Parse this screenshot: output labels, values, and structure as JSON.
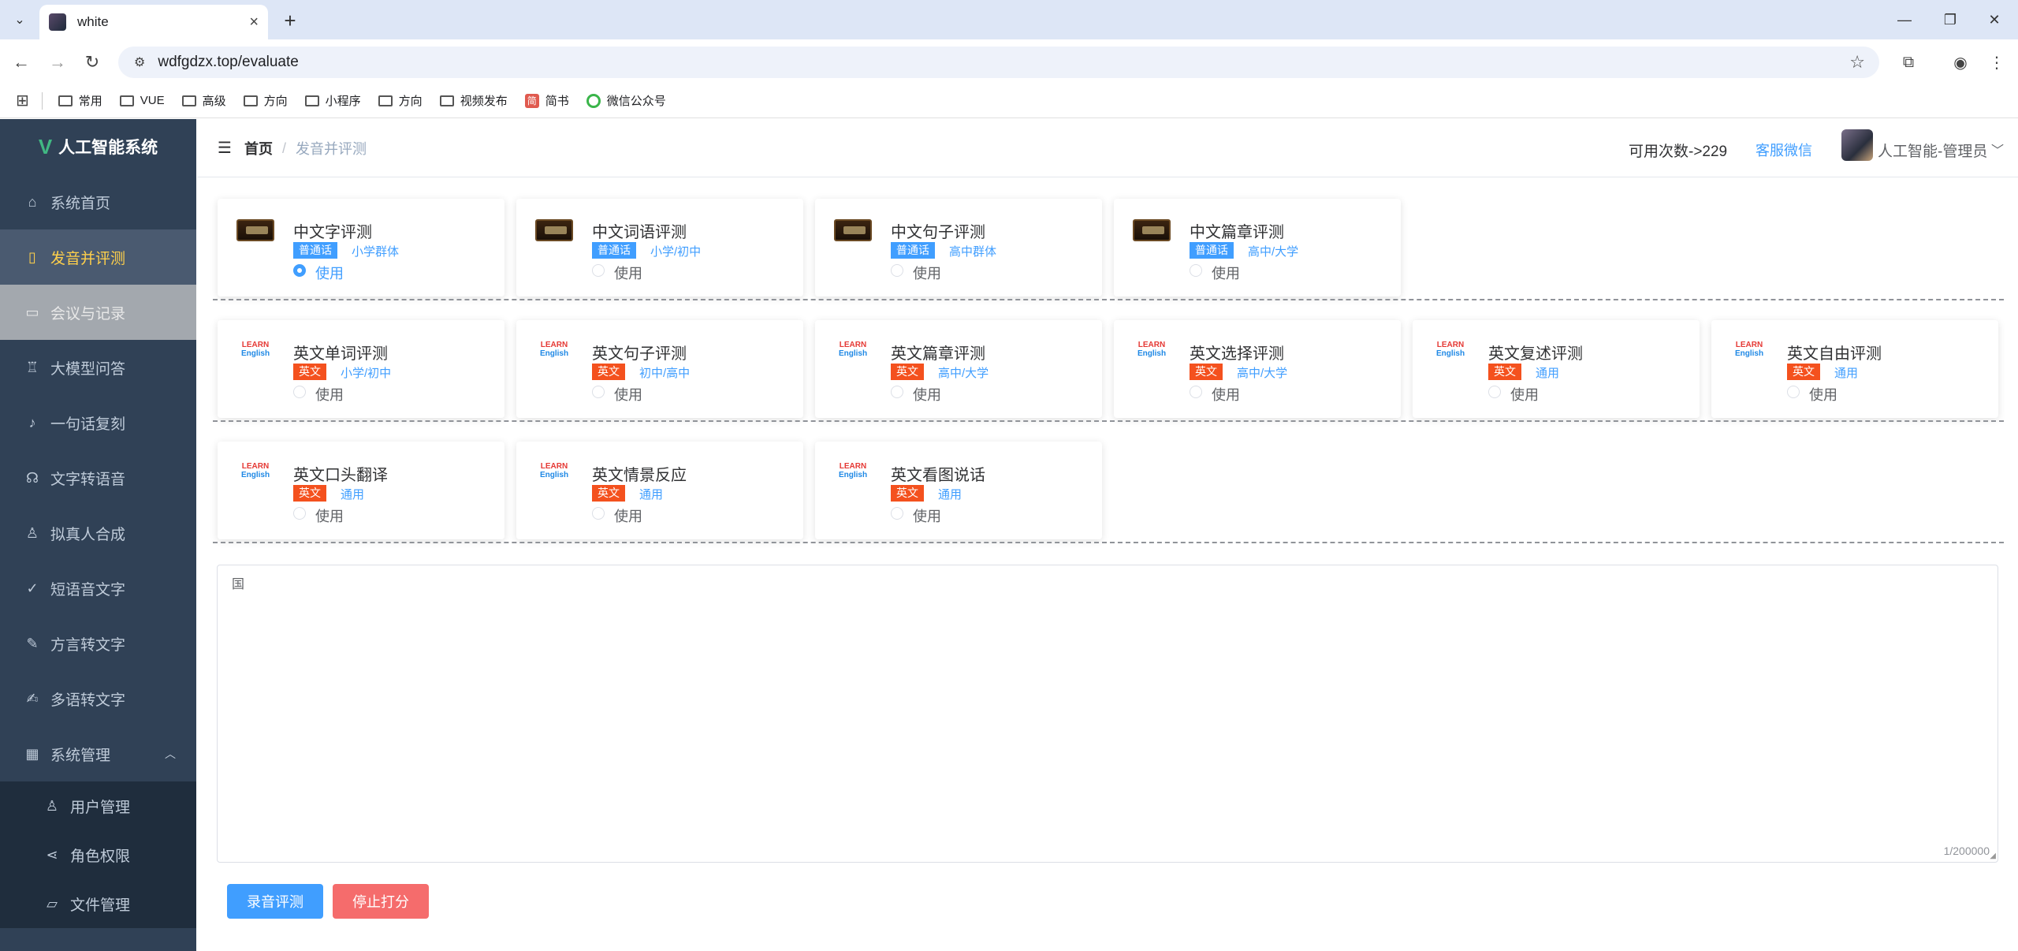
{
  "browser": {
    "tab_title": "white",
    "url": "wdfgdzx.top/evaluate",
    "bookmarks": [
      "常用",
      "VUE",
      "高级",
      "方向",
      "小程序",
      "方向",
      "视频发布",
      "简书",
      "微信公众号"
    ],
    "jianshu_glyph": "简"
  },
  "sidebar": {
    "logo_letter": "V",
    "logo_text": "人工智能系统",
    "items": [
      {
        "label": "系统首页",
        "icon": "home-icon"
      },
      {
        "label": "发音并评测",
        "icon": "book-icon"
      },
      {
        "label": "会议与记录",
        "icon": "monitor-icon"
      },
      {
        "label": "大模型问答",
        "icon": "trophy-icon"
      },
      {
        "label": "一句话复刻",
        "icon": "microphone-icon"
      },
      {
        "label": "文字转语音",
        "icon": "headset-icon"
      },
      {
        "label": "拟真人合成",
        "icon": "user-icon"
      },
      {
        "label": "短语音文字",
        "icon": "edit-check-icon"
      },
      {
        "label": "方言转文字",
        "icon": "pen-icon"
      },
      {
        "label": "多语转文字",
        "icon": "edit-icon"
      },
      {
        "label": "系统管理",
        "icon": "grid-icon"
      }
    ],
    "subitems": [
      {
        "label": "用户管理",
        "icon": "user-icon"
      },
      {
        "label": "角色权限",
        "icon": "share-icon"
      },
      {
        "label": "文件管理",
        "icon": "folder-icon"
      }
    ]
  },
  "header": {
    "breadcrumb_home": "首页",
    "breadcrumb_sep": "/",
    "breadcrumb_current": "发音并评测",
    "uses": "可用次数->229",
    "service": "客服微信",
    "user_name": "人工智能-管理员"
  },
  "cards_row1": [
    {
      "title": "中文字评测",
      "tag": "普通话",
      "level": "小学群体",
      "radio": "使用",
      "selected": true
    },
    {
      "title": "中文词语评测",
      "tag": "普通话",
      "level": "小学/初中",
      "radio": "使用",
      "selected": false
    },
    {
      "title": "中文句子评测",
      "tag": "普通话",
      "level": "高中群体",
      "radio": "使用",
      "selected": false
    },
    {
      "title": "中文篇章评测",
      "tag": "普通话",
      "level": "高中/大学",
      "radio": "使用",
      "selected": false
    }
  ],
  "cards_row2": [
    {
      "title": "英文单词评测",
      "tag": "英文",
      "level": "小学/初中",
      "radio": "使用"
    },
    {
      "title": "英文句子评测",
      "tag": "英文",
      "level": "初中/高中",
      "radio": "使用"
    },
    {
      "title": "英文篇章评测",
      "tag": "英文",
      "level": "高中/大学",
      "radio": "使用"
    },
    {
      "title": "英文选择评测",
      "tag": "英文",
      "level": "高中/大学",
      "radio": "使用"
    },
    {
      "title": "英文复述评测",
      "tag": "英文",
      "level": "通用",
      "radio": "使用"
    },
    {
      "title": "英文自由评测",
      "tag": "英文",
      "level": "通用",
      "radio": "使用"
    }
  ],
  "cards_row3": [
    {
      "title": "英文口头翻译",
      "tag": "英文",
      "level": "通用",
      "radio": "使用"
    },
    {
      "title": "英文情景反应",
      "tag": "英文",
      "level": "通用",
      "radio": "使用"
    },
    {
      "title": "英文看图说话",
      "tag": "英文",
      "level": "通用",
      "radio": "使用"
    }
  ],
  "textarea": {
    "value": "国",
    "count": "1/200000"
  },
  "buttons": {
    "record": "录音评测",
    "stop": "停止打分"
  },
  "colors": {
    "primary": "#409eff",
    "danger": "#f56c6c",
    "english_tag": "#f4511e",
    "sidebar": "#304156",
    "active_text": "#ffd04b"
  }
}
